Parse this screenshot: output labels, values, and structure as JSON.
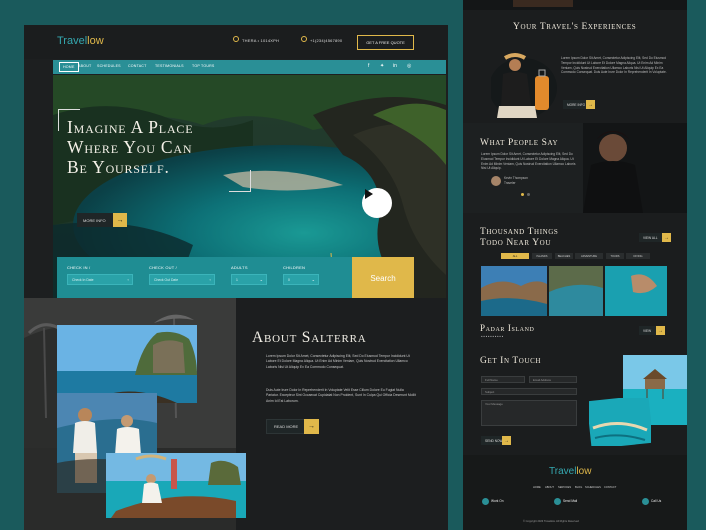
{
  "header": {
    "logo_part1": "Travel",
    "logo_part2": "low",
    "phone": "THERA • 1014XPH",
    "phone2": "+1(234)4567890",
    "quote_button": "GET A FREE QUOTE"
  },
  "nav": {
    "items": [
      "HOME",
      "ABOUT",
      "SCHEDULES",
      "CONTACT",
      "TESTIMONIALS",
      "TOP TOURS"
    ],
    "social_icons": [
      "facebook-icon",
      "twitter-icon",
      "linkedin-icon",
      "instagram-icon"
    ]
  },
  "hero": {
    "title_line1": "Imagine A Place",
    "title_line2": "Where You Can",
    "title_line3": "Be Yourself.",
    "more_button": "MORE INFO",
    "arrow": "→"
  },
  "search": {
    "checkin_label": "CHECK IN /",
    "checkin_placeholder": "Check In Date",
    "checkout_label": "CHECK OUT /",
    "checkout_placeholder": "Check Out Date",
    "adults_label": "ADULTS",
    "adults_value": "1",
    "children_label": "CHILDREN",
    "children_value": "0",
    "search_button": "Search"
  },
  "about": {
    "title": "About Salterra",
    "paragraph1": "Lorem Ipsum Dolor Sit Amet, Consectetur Adipiscing Elit, Sed Do Eiusmod Tempor Incididunt Ut Labore Et Dolore Magna Aliqua. Ut Enim Ad Minim Veniam, Quis Nostrud Exercitation Ullamco Laboris Nisi Ut Aliquip Ex Ea Commodo Consequat.",
    "paragraph2": "Duis Aute Irure Dolor In Reprehenderit In Voluptate Velit Esse Cillum Dolore Eu Fugiat Nulla Pariatur. Excepteur Sint Occaecat Cupidatat Non Proident, Sunt In Culpa Qui Officia Deserunt Mollit Anim Id Est Laborum.",
    "read_more": "READ MORE",
    "arrow": "→"
  },
  "right": {
    "experiences_title": "Your Travel's Experiences",
    "experiences_text": "Lorem Ipsum Dolor Sit Amet, Consectetur Adipiscing Elit, Sed Do Eiusmod Tempor Incididunt Ut Labore Et Dolore Magna Aliqua. Ut Enim Ad Minim Veniam, Quis Nostrud Exercitation Ullamco Laboris Nisi Ut Aliquip Ex Ea Commodo Consequat. Duis Aute Irure Dolor In Reprehenderit In Voluptate.",
    "experiences_button": "MORE INFO",
    "people_title": "What People Say",
    "people_text": "Lorem Ipsum Dolor Sit Amet, Consectetur Adipiscing Elit, Sed Do Eiusmod Tempor Incididunt Ut Labore Et Dolore Magna Aliqua. Ut Enim Ad Minim Veniam, Quis Nostrud Exercitation Ullamco Laboris Nisi Ut Aliquip.",
    "reviewer_name": "Kevin Thompson",
    "reviewer_role": "Traveler",
    "things_title_line1": "Thousand Things",
    "things_title_line2": "Todo Near You",
    "things_button": "VIEW ALL",
    "chips": [
      "ALL",
      "ISLANDS",
      "BEACHES",
      "ADVENTURE",
      "TOURS",
      "DIVING"
    ],
    "island_name": "Padar Island",
    "island_button": "VIEW",
    "contact_title": "Get In Touch",
    "form_name": "Full Name",
    "form_email": "Email Address",
    "form_subject": "Subject",
    "form_message": "Your Message",
    "form_button": "SEND NOW",
    "footer_logo_part1": "Travel",
    "footer_logo_part2": "low",
    "footer_links": [
      "HOME",
      "ABOUT",
      "SERVICES",
      "BLOG",
      "SCHEDULES",
      "CONTACT"
    ],
    "footer_info": [
      "Work On",
      "Send Mail",
      "Call Us"
    ],
    "copyright": "© Copyright 2023 Travellow. All Rights Reserved"
  }
}
